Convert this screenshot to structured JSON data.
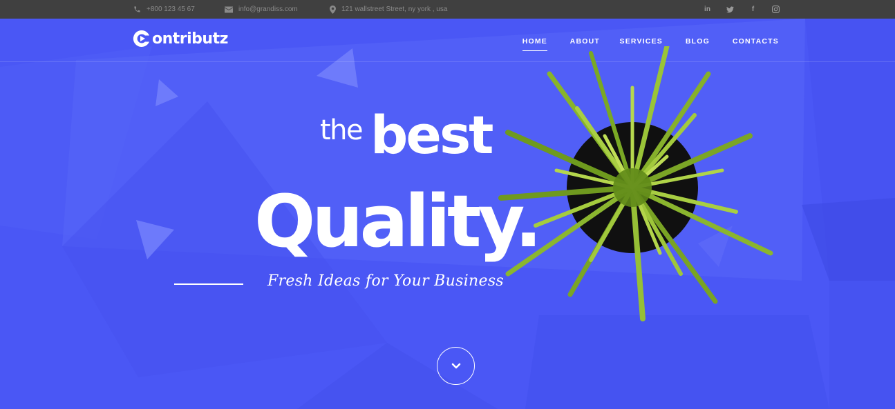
{
  "topbar": {
    "phone": "+800 123 45 67",
    "email": "info@grandiss.com",
    "address": "121 wallstreet Street, ny york , usa",
    "social": [
      {
        "name": "linkedin-icon",
        "glyph": "in"
      },
      {
        "name": "twitter-icon",
        "glyph": ""
      },
      {
        "name": "facebook-icon",
        "glyph": "f"
      },
      {
        "name": "instagram-icon",
        "glyph": ""
      }
    ]
  },
  "brand": {
    "name": "ontributz",
    "accent": "#4a57f5"
  },
  "nav": {
    "items": [
      {
        "label": "HOME",
        "active": true
      },
      {
        "label": "ABOUT",
        "active": false
      },
      {
        "label": "SERVICES",
        "active": false
      },
      {
        "label": "BLOG",
        "active": false
      },
      {
        "label": "CONTACTS",
        "active": false
      }
    ]
  },
  "hero": {
    "line1a": "the",
    "line1b": "best",
    "line2": "Quality.",
    "tagline": "Fresh Ideas for Your Business",
    "scroll_icon": "chevron-down-icon"
  }
}
